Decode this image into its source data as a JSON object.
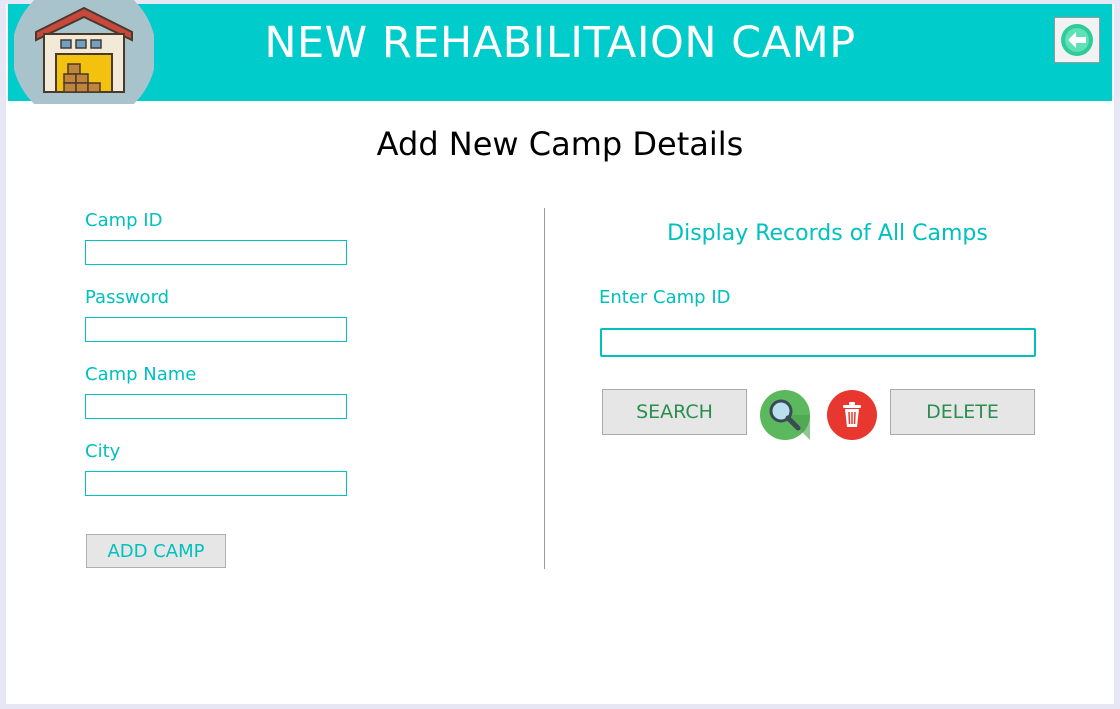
{
  "header": {
    "title": "NEW REHABILITAION CAMP",
    "logo_icon": "warehouse-icon",
    "back_icon": "back-arrow-icon",
    "color": "#00cccc"
  },
  "page_title": "Add New Camp Details",
  "form": {
    "fields": [
      {
        "label": "Camp ID",
        "value": ""
      },
      {
        "label": "Password",
        "value": ""
      },
      {
        "label": "Camp Name",
        "value": ""
      },
      {
        "label": "City",
        "value": ""
      }
    ],
    "add_button": "ADD CAMP"
  },
  "records": {
    "title": "Display Records of All Camps",
    "search_label": "Enter Camp ID",
    "search_value": "",
    "search_button": "SEARCH",
    "search_icon": "magnifier-icon",
    "delete_icon": "trash-icon",
    "delete_button": "DELETE"
  }
}
